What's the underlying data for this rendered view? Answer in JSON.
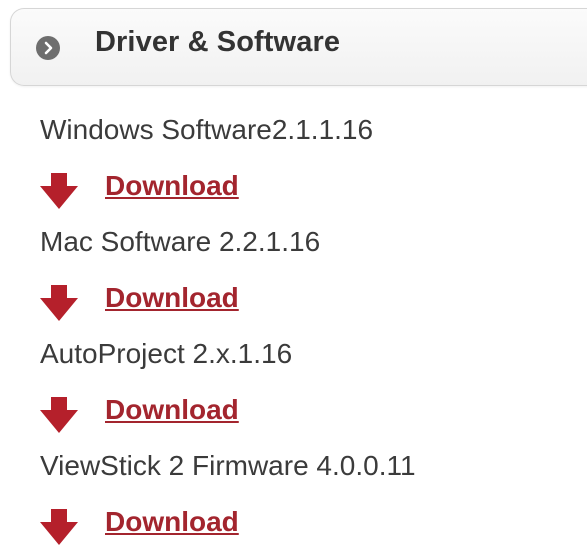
{
  "panel": {
    "title": "Driver & Software",
    "icon": "chevron-right-circle-icon"
  },
  "items": [
    {
      "name": "Windows Software2.1.1.16",
      "link_label": "Download"
    },
    {
      "name": "Mac Software 2.2.1.16",
      "link_label": "Download"
    },
    {
      "name": "AutoProject 2.x.1.16",
      "link_label": "Download"
    },
    {
      "name": "ViewStick 2 Firmware 4.0.0.11",
      "link_label": "Download"
    }
  ],
  "colors": {
    "link": "#a3252e",
    "arrow": "#b5202b",
    "text": "#3b3b3b",
    "header_icon": "#6e6e6e"
  }
}
